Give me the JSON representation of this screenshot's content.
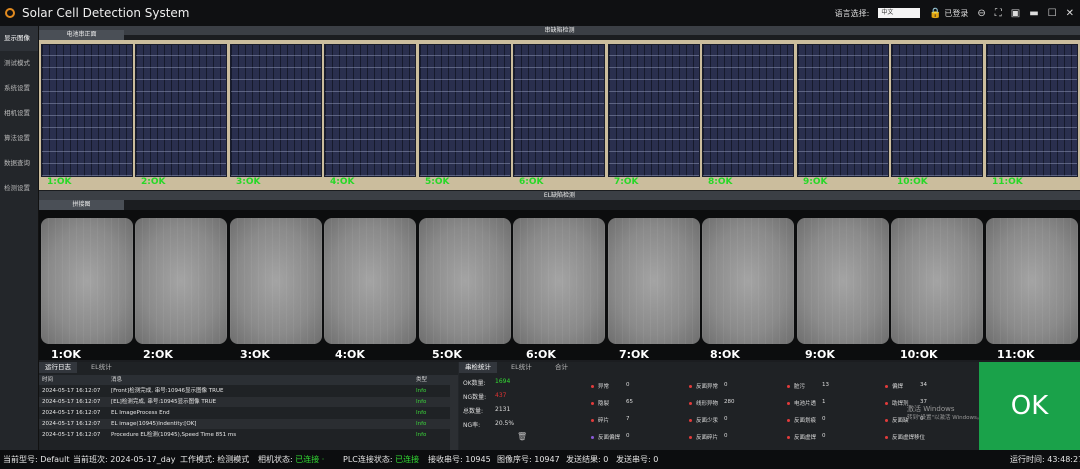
{
  "app": {
    "title": "Solar Cell Detection System"
  },
  "titlebar": {
    "lang_label": "语言选择:",
    "lang_value": "中文",
    "login_text": "已登录"
  },
  "sidebar": {
    "items": [
      "显示图像",
      "测试模式",
      "系统设置",
      "相机设置",
      "算法设置",
      "数据查询",
      "检测设置"
    ]
  },
  "section1": {
    "header": "串缺陷检测",
    "tab": "电池串正面"
  },
  "section2": {
    "header": "EL缺陷检测",
    "tab": "拼接图"
  },
  "cells_front": [
    "1:OK",
    "2:OK",
    "3:OK",
    "4:OK",
    "5:OK",
    "6:OK",
    "7:OK",
    "8:OK",
    "9:OK",
    "10:OK",
    "11:OK"
  ],
  "cells_el": [
    "1:OK",
    "2:OK",
    "3:OK",
    "4:OK",
    "5:OK",
    "6:OK",
    "7:OK",
    "8:OK",
    "9:OK",
    "10:OK",
    "11:OK"
  ],
  "log": {
    "tabs": [
      "运行日志",
      "EL统计"
    ],
    "columns": [
      "时间",
      "消息",
      "类型"
    ],
    "rows": [
      {
        "time": "2024-05-17 16:12:07",
        "msg": "[Front]检测完成, 串号:10946显示图像 TRUE",
        "type": "Info"
      },
      {
        "time": "2024-05-17 16:12:07",
        "msg": "[EL]检测完成, 串号:10945显示图像 TRUE",
        "type": "Info"
      },
      {
        "time": "2024-05-17 16:12:07",
        "msg": "EL ImageProcess End",
        "type": "Info"
      },
      {
        "time": "2024-05-17 16:12:07",
        "msg": "EL image(10945)Indentity:[OK]",
        "type": "Info"
      },
      {
        "time": "2024-05-17 16:12:07",
        "msg": "Procedure EL检测(10945),Speed Time 851 ms",
        "type": "Info"
      }
    ]
  },
  "stats": {
    "tabs": [
      "串检统计",
      "EL统计",
      "合计"
    ],
    "summary": [
      {
        "label": "OK数量:",
        "value": "1694"
      },
      {
        "label": "NG数量:",
        "value": "437"
      },
      {
        "label": "总数量:",
        "value": "2131"
      },
      {
        "label": "NG率:",
        "value": "20.5%"
      }
    ],
    "defects": [
      {
        "name": "异常",
        "value": "0"
      },
      {
        "name": "反面异常",
        "value": "0"
      },
      {
        "name": "脏污",
        "value": "13"
      },
      {
        "name": "偏焊",
        "value": "34"
      },
      {
        "name": "隐裂",
        "value": "65"
      },
      {
        "name": "线形异物",
        "value": "280"
      },
      {
        "name": "电池片透",
        "value": "1"
      },
      {
        "name": "助焊剂",
        "value": "37"
      },
      {
        "name": "碎片",
        "value": "7"
      },
      {
        "name": "反面少汞",
        "value": "0"
      },
      {
        "name": "反面划痕",
        "value": "0"
      },
      {
        "name": "反面缺",
        "value": "0"
      },
      {
        "name": "反面偏焊",
        "value": "0"
      },
      {
        "name": "反面碎片",
        "value": "0"
      },
      {
        "name": "反面虚焊",
        "value": "0"
      },
      {
        "name": "反面虚焊移位",
        "value": ""
      }
    ]
  },
  "result": {
    "text": "OK"
  },
  "watermark": {
    "line1": "激活 Windows",
    "line2": "转到\"设置\"以激活 Windows。"
  },
  "statusbar": {
    "model_label": "当前型号:",
    "model": "Default",
    "shift_label": "当前班次:",
    "shift": "2024-05-17_day",
    "mode_label": "工作模式:",
    "mode": "检测模式",
    "camera_label": "相机状态:",
    "camera": "已连接",
    "plc_label": "PLC连接状态:",
    "plc": "已连接",
    "recv_label": "接收串号:",
    "recv": "10945",
    "img_label": "图像序号:",
    "img": "10947",
    "sendres_label": "发送结果:",
    "sendres": "0",
    "sendno_label": "发送串号:",
    "sendno": "0",
    "runtime_label": "运行时间:",
    "runtime": "43:48:27"
  },
  "colors": {
    "ok_green": "#1aa24a",
    "label_green": "#27d827",
    "status_green": "#33dd33"
  }
}
